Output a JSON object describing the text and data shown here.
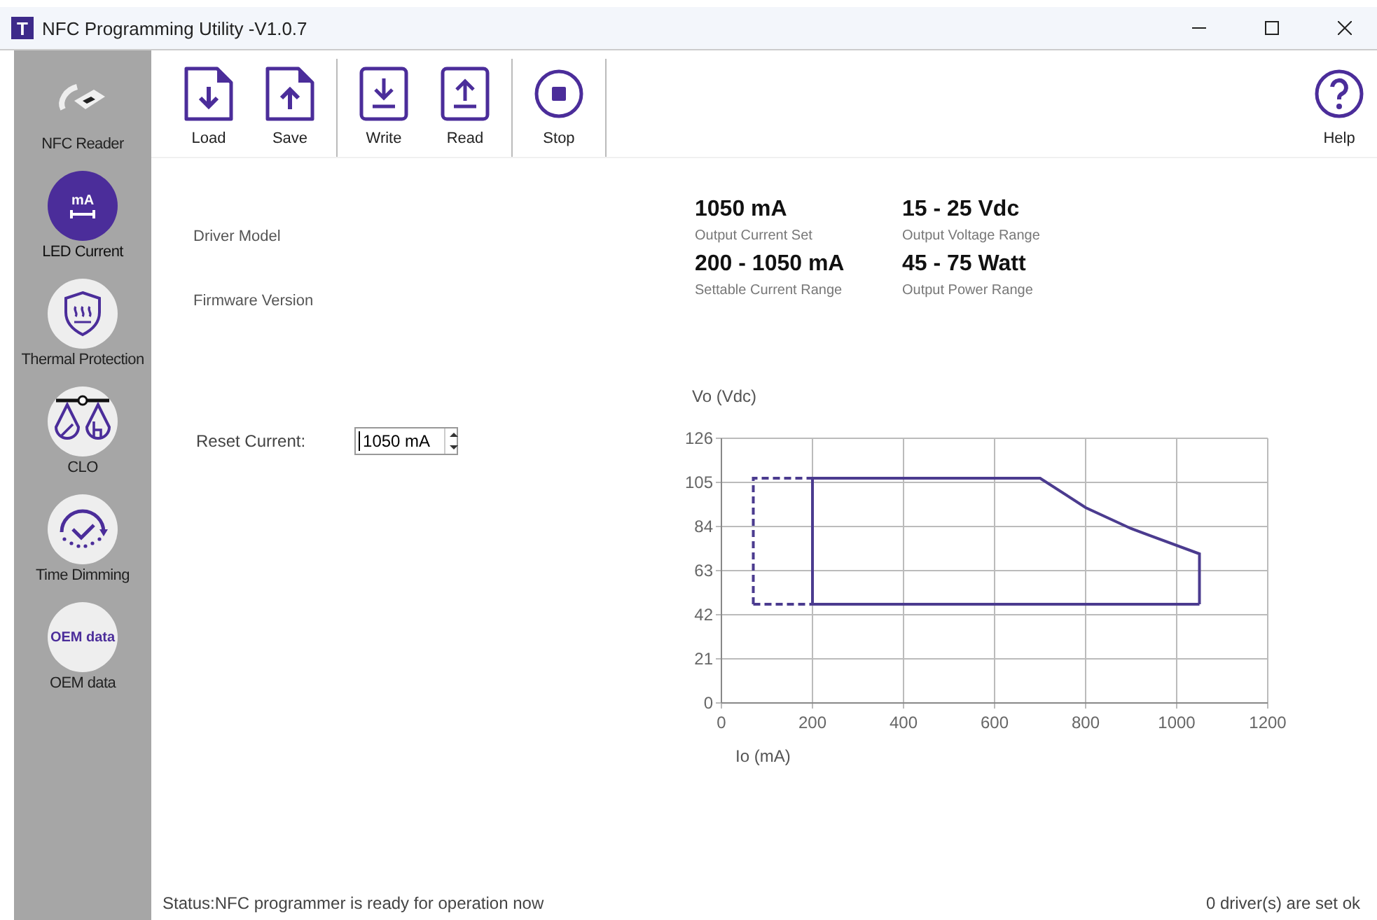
{
  "window": {
    "logo": "T",
    "title": "NFC Programming Utility -V1.0.7"
  },
  "sidebar": {
    "items": [
      {
        "kind": "reader",
        "label": "NFC Reader",
        "selected": false
      },
      {
        "kind": "current",
        "label": "LED Current",
        "icon_text": "mA",
        "selected": true
      },
      {
        "kind": "thermal",
        "label": "Thermal Protection",
        "selected": false
      },
      {
        "kind": "clo",
        "label": "CLO",
        "selected": false
      },
      {
        "kind": "dimming",
        "label": "Time Dimming",
        "selected": false
      },
      {
        "kind": "oem",
        "label": "OEM data",
        "icon_text": "OEM data",
        "selected": false
      }
    ]
  },
  "toolbar": {
    "groups": [
      [
        {
          "kind": "load",
          "label": "Load"
        },
        {
          "kind": "save",
          "label": "Save"
        }
      ],
      [
        {
          "kind": "write",
          "label": "Write"
        },
        {
          "kind": "read",
          "label": "Read"
        }
      ],
      [
        {
          "kind": "stop",
          "label": "Stop"
        }
      ]
    ],
    "help": {
      "kind": "help",
      "label": "Help"
    }
  },
  "driver_info": [
    "Driver Model",
    "Firmware Version"
  ],
  "specs": [
    {
      "value": "1050 mA",
      "caption": "Output Current Set"
    },
    {
      "value": "15 - 25 Vdc",
      "caption": "Output Voltage Range"
    },
    {
      "value": "200 - 1050 mA",
      "caption": "Settable Current Range"
    },
    {
      "value": "45 - 75 Watt",
      "caption": "Output Power Range"
    }
  ],
  "reset_current": {
    "label": "Reset Current:",
    "value": "1050 mA"
  },
  "chart": {
    "chart_data": {
      "type": "line",
      "xlabel": "Io (mA)",
      "ylabel": "Vo (Vdc)",
      "xlim": [
        0,
        1200
      ],
      "ylim": [
        0,
        126
      ],
      "xticks": [
        0,
        200,
        400,
        600,
        800,
        1000,
        1200
      ],
      "yticks": [
        0,
        21,
        42,
        63,
        84,
        105,
        126
      ],
      "grid": true,
      "series": [
        {
          "color": "#4b3b8f",
          "line_style": "solid",
          "x": [
            200,
            200,
            700,
            800,
            900,
            1050,
            1050
          ],
          "values": [
            47,
            107,
            107,
            93,
            83,
            71,
            47
          ]
        },
        {
          "color": "#4b3b8f",
          "line_style": "solid",
          "x": [
            200,
            1050
          ],
          "values": [
            47,
            47
          ]
        },
        {
          "color": "#4b3b8f",
          "line_style": "dashed",
          "x": [
            70,
            70,
            200
          ],
          "values": [
            47,
            107,
            107
          ]
        },
        {
          "color": "#4b3b8f",
          "line_style": "dashed",
          "x": [
            70,
            200
          ],
          "values": [
            47,
            47
          ]
        }
      ]
    }
  },
  "status_bar": {
    "status": "Status:NFC programmer is ready for operation now",
    "count": "0 driver(s) are set ok"
  }
}
